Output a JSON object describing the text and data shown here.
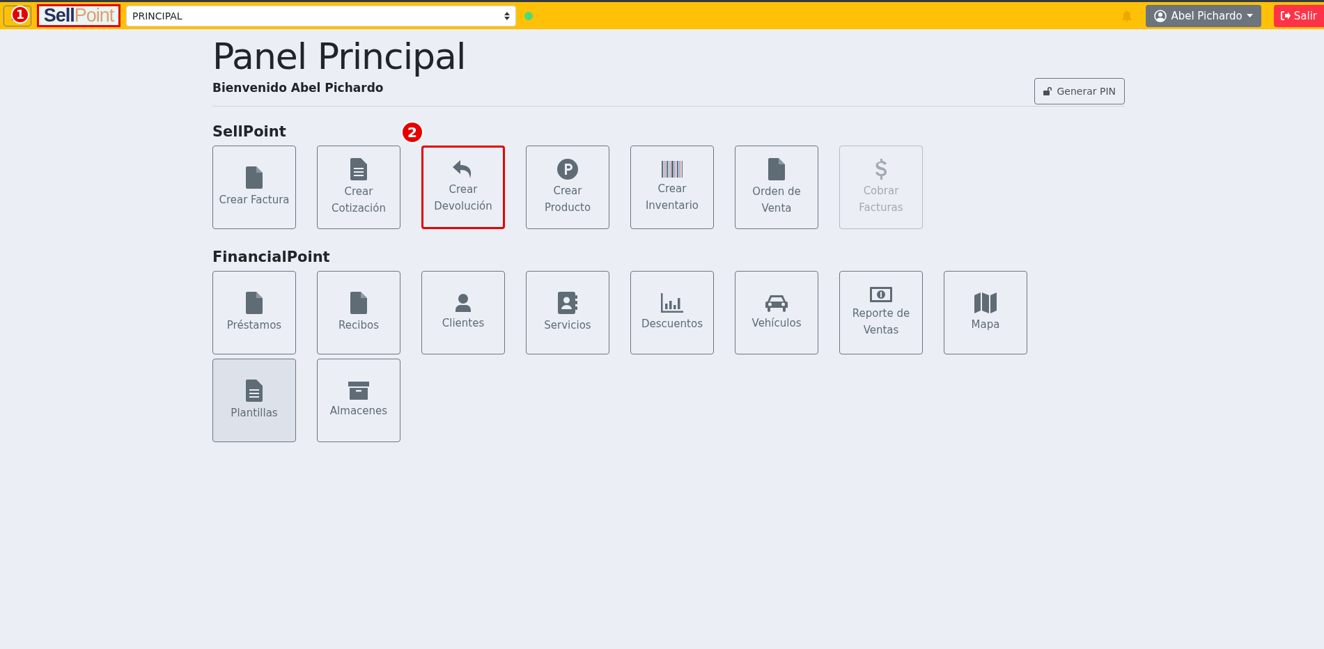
{
  "navbar": {
    "logo": {
      "part_1": "Sell",
      "part_2": "Point",
      "highlighted": true,
      "marker": "1"
    },
    "branch_select": {
      "value": "PRINCIPAL"
    },
    "connection_online": true,
    "user_menu": {
      "label": "Abel Pichardo"
    },
    "logout_button": {
      "label": "Salir"
    }
  },
  "page": {
    "title": "Panel Principal",
    "welcome": "Bienvenido Abel Pichardo",
    "pin_button": {
      "label": "Generar PIN"
    }
  },
  "sections": [
    {
      "title": "SellPoint",
      "tiles": [
        {
          "label": "Crear Factura",
          "disabled": false,
          "active": false,
          "highlighted": false
        },
        {
          "label": "Crear Cotización",
          "disabled": false,
          "active": false,
          "highlighted": false
        },
        {
          "label": "Crear Devolución",
          "disabled": false,
          "active": false,
          "highlighted": true,
          "marker": "2"
        },
        {
          "label": "Crear Producto",
          "disabled": false,
          "active": false,
          "highlighted": false
        },
        {
          "label": "Crear Inventario",
          "disabled": false,
          "active": false,
          "highlighted": false
        },
        {
          "label": "Orden de Venta",
          "disabled": false,
          "active": false,
          "highlighted": false
        },
        {
          "label": "Cobrar Facturas",
          "disabled": true,
          "active": false,
          "highlighted": false
        }
      ]
    },
    {
      "title": "FinancialPoint",
      "tiles": [
        {
          "label": "Préstamos",
          "disabled": false,
          "active": false,
          "highlighted": false
        },
        {
          "label": "Recibos",
          "disabled": false,
          "active": false,
          "highlighted": false
        },
        {
          "label": "Clientes",
          "disabled": false,
          "active": false,
          "highlighted": false
        },
        {
          "label": "Servicios",
          "disabled": false,
          "active": false,
          "highlighted": false
        },
        {
          "label": "Descuentos",
          "disabled": false,
          "active": false,
          "highlighted": false
        },
        {
          "label": "Vehículos",
          "disabled": false,
          "active": false,
          "highlighted": false
        },
        {
          "label": "Reporte de Ventas",
          "disabled": false,
          "active": false,
          "highlighted": false
        },
        {
          "label": "Mapa",
          "disabled": false,
          "active": false,
          "highlighted": false
        },
        {
          "label": "Plantillas",
          "disabled": false,
          "active": true,
          "highlighted": false
        },
        {
          "label": "Almacenes",
          "disabled": false,
          "active": false,
          "highlighted": false
        }
      ]
    }
  ]
}
